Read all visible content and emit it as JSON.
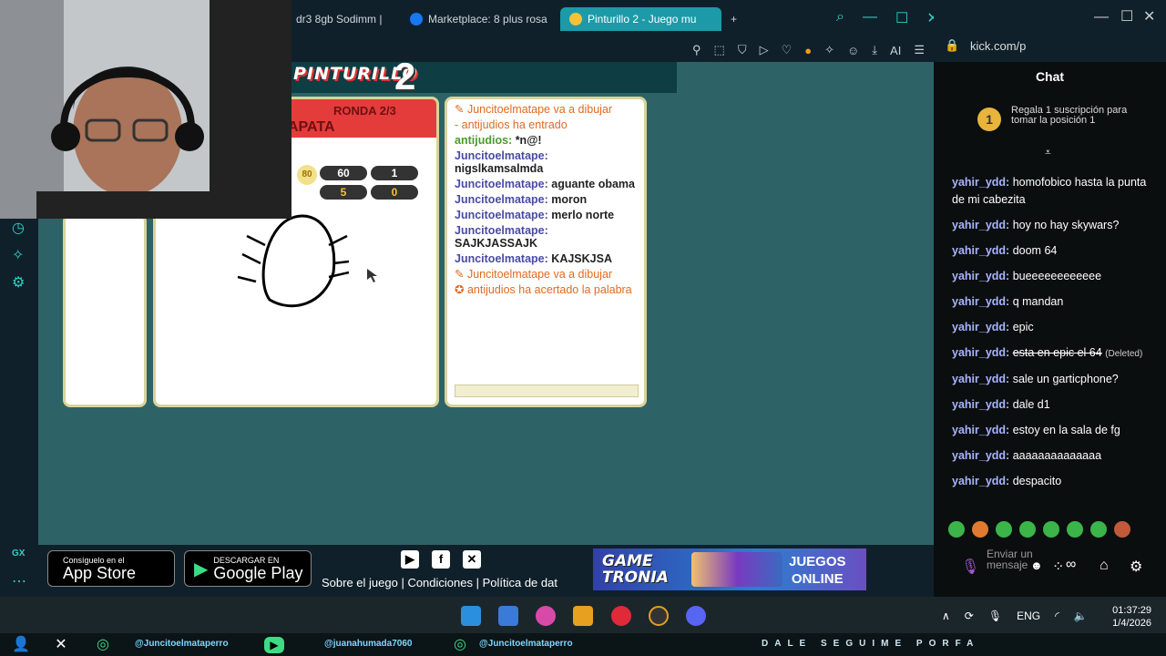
{
  "browser": {
    "tabs": [
      {
        "label": "dr3 8gb Sodimm |",
        "active": false
      },
      {
        "label": "Marketplace: 8 plus rosa",
        "active": false
      },
      {
        "label": "Pinturillo 2 - Juego mu",
        "active": true
      }
    ],
    "new_tab": "+",
    "ai_label": "AI"
  },
  "game": {
    "logo_text": "PINTURILLO",
    "logo_num": "2",
    "round_label": "RONDA 2/3",
    "word": "APATA",
    "timer": "80",
    "scores": [
      "60",
      "1",
      "5",
      "0"
    ],
    "chat": [
      {
        "type": "sys",
        "text": "Juncitoelmatape va a dibujar"
      },
      {
        "type": "sys",
        "text": "- antijudios ha entrado"
      },
      {
        "type": "msg",
        "user": "antijudios:",
        "text": "*n@!",
        "green": true
      },
      {
        "type": "msg",
        "user": "Juncitoelmatape:",
        "text": "nigslkamsalmda"
      },
      {
        "type": "msg",
        "user": "Juncitoelmatape:",
        "text": "aguante obama"
      },
      {
        "type": "msg",
        "user": "Juncitoelmatape:",
        "text": "moron"
      },
      {
        "type": "msg",
        "user": "Juncitoelmatape:",
        "text": "merlo norte"
      },
      {
        "type": "msg",
        "user": "Juncitoelmatape:",
        "text": "SAJKJASSAJK"
      },
      {
        "type": "msg",
        "user": "Juncitoelmatape:",
        "text": "KAJSKJSA"
      },
      {
        "type": "sys",
        "text": "Juncitoelmatape va a dibujar"
      },
      {
        "type": "sys",
        "text": "antijudios ha acertado la palabra"
      }
    ]
  },
  "footer": {
    "appstore_small": "Consíguelo en el",
    "appstore_big": "App Store",
    "gplay_small": "DESCARGAR EN",
    "gplay_big": "Google Play",
    "links": "Sobre el juego | Condiciones | Política de dat",
    "banner_left_1": "GAME",
    "banner_left_2": "TRONIA",
    "banner_right_1": "JUEGOS",
    "banner_right_2": "ONLINE"
  },
  "kick": {
    "url": "kick.com/p",
    "chat_title": "Chat",
    "gift_badge": "1",
    "gift_text": "Regala 1 suscripción para tomar la posición 1",
    "messages": [
      {
        "user": "yahir_ydd:",
        "text": "homofobico hasta la punta de mi cabezita"
      },
      {
        "user": "yahir_ydd:",
        "text": "hoy no hay skywars?"
      },
      {
        "user": "yahir_ydd:",
        "text": "doom 64"
      },
      {
        "user": "yahir_ydd:",
        "text": "bueeeeeeeeeeee"
      },
      {
        "user": "yahir_ydd:",
        "text": "q mandan"
      },
      {
        "user": "yahir_ydd:",
        "text": "epic"
      },
      {
        "user": "yahir_ydd:",
        "text": "esta en epic el 64",
        "deleted": "(Deleted)"
      },
      {
        "user": "yahir_ydd:",
        "text": "sale un garticphone?"
      },
      {
        "user": "yahir_ydd:",
        "text": "dale d1"
      },
      {
        "user": "yahir_ydd:",
        "text": "estoy en la sala de fg"
      },
      {
        "user": "yahir_ydd:",
        "text": "aaaaaaaaaaaaaa"
      },
      {
        "user": "yahir_ydd:",
        "text": "despacito"
      }
    ],
    "send_placeholder": "Enviar un mensaje",
    "infinity": "∞"
  },
  "taskbar": {
    "lang": "ENG",
    "time": "01:37:29",
    "date": "1/4/2026"
  },
  "social": {
    "handle1": "@Juncitoelmataperro",
    "handle2": "@juanahumada7060",
    "handle3": "@Juncitoelmataperro",
    "slogan": "DALE SEGUIME PORFA"
  },
  "colors": {
    "accent": "#1c9aa8",
    "game_bg": "#2d6366",
    "panel_border": "#d9d39a",
    "round_red": "#e43b3b"
  }
}
